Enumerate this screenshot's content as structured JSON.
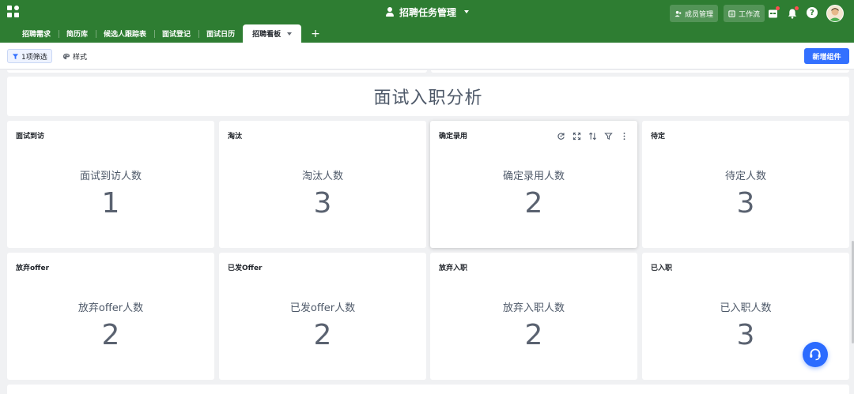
{
  "header": {
    "title": "招聘任务管理",
    "members_label": "成员管理",
    "workflow_label": "工作流",
    "help_glyph": "?"
  },
  "tabs": [
    {
      "label": "招聘需求"
    },
    {
      "label": "简历库"
    },
    {
      "label": "候选人跟踪表"
    },
    {
      "label": "面试登记"
    },
    {
      "label": "面试日历"
    },
    {
      "label": "招聘看板",
      "active": true
    }
  ],
  "tab_add_glyph": "+",
  "toolbar": {
    "filter_label": "1项筛选",
    "style_label": "样式",
    "new_component_label": "新增组件"
  },
  "dashboard": {
    "title": "面试入职分析",
    "cards": [
      {
        "title": "面试到访",
        "label": "面试到访人数",
        "value": "1"
      },
      {
        "title": "淘汰",
        "label": "淘汰人数",
        "value": "3"
      },
      {
        "title": "确定录用",
        "label": "确定录用人数",
        "value": "2"
      },
      {
        "title": "待定",
        "label": "待定人数",
        "value": "3"
      },
      {
        "title": "放弃offer",
        "label": "放弃offer人数",
        "value": "2"
      },
      {
        "title": "已发Offer",
        "label": "已发offer人数",
        "value": "2"
      },
      {
        "title": "放弃入职",
        "label": "放弃入职人数",
        "value": "2"
      },
      {
        "title": "已入职",
        "label": "已入职人数",
        "value": "3"
      }
    ]
  },
  "colors": {
    "header_green": "#2e7d32",
    "primary_blue": "#3370ff",
    "support_blue": "#2b6bff"
  },
  "icons": [
    "apps-icon",
    "user-icon",
    "members-icon",
    "workflow-icon",
    "calendar-icon",
    "bell-icon",
    "help-icon",
    "filter-icon",
    "style-icon",
    "refresh-icon",
    "fullscreen-icon",
    "sort-icon",
    "filter-icon",
    "more-icon",
    "customer-service-icon"
  ]
}
